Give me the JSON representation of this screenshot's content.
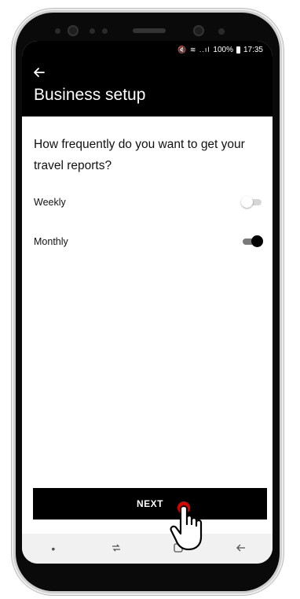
{
  "status_bar": {
    "icons": "🔇 ≋ ..ıl",
    "battery": "100%",
    "time": "17:35"
  },
  "header": {
    "back_icon": "arrow-left-icon",
    "title": "Business setup"
  },
  "question": "How frequently do you want to get your travel reports?",
  "options": [
    {
      "label": "Weekly",
      "enabled": false
    },
    {
      "label": "Monthly",
      "enabled": true
    }
  ],
  "next_button": {
    "label": "NEXT"
  },
  "nav_bar": {
    "items": [
      "recents-icon",
      "home-icon",
      "back-icon"
    ]
  },
  "colors": {
    "header_bg": "#000000",
    "button_bg": "#000000",
    "tap_indicator": "#e00000"
  }
}
